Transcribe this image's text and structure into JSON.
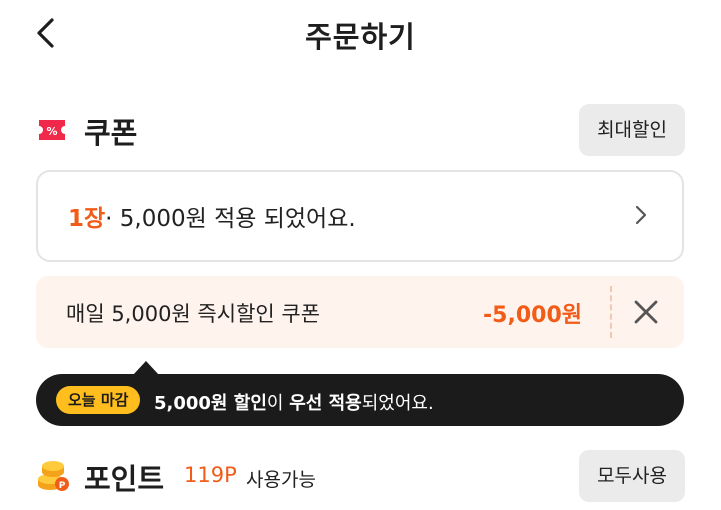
{
  "header": {
    "title": "주문하기",
    "back_icon": "chevron-left-icon"
  },
  "coupon": {
    "title": "쿠폰",
    "icon": "coupon-ticket-icon",
    "max_discount_label": "최대할인",
    "applied_count": "1장",
    "applied_text": "· 5,000원 적용 되었어요.",
    "item": {
      "name": "매일 5,000원 즉시할인 쿠폰",
      "amount": "-5,000원",
      "remove_icon": "close-icon"
    }
  },
  "tooltip": {
    "badge": "오늘 마감",
    "amount": "5,000원 할인",
    "particle": "이 ",
    "priority": "우선 적용",
    "suffix": "되었어요."
  },
  "point": {
    "title": "포인트",
    "icon": "coins-icon",
    "available_amount": "119P",
    "available_label": "사용가능",
    "use_all_label": "모두사용"
  },
  "colors": {
    "accent": "#f25c19",
    "tooltip_bg": "#1b1b1b",
    "badge": "#ffbe1e",
    "coupon_bg": "#fff3ed"
  }
}
